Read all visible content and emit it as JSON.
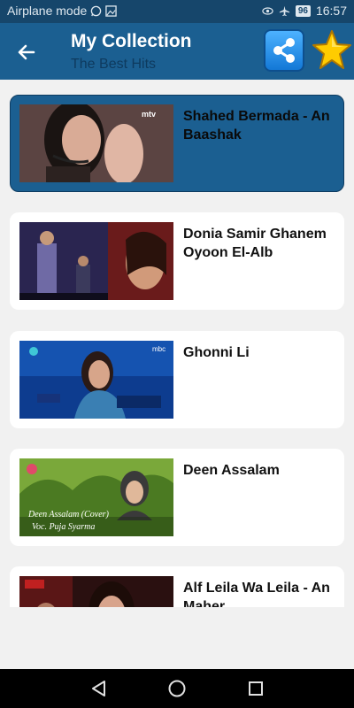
{
  "status_bar": {
    "mode": "Airplane mode",
    "battery": "96",
    "time": "16:57",
    "icons": [
      "whatsapp-icon",
      "image-icon",
      "eye-icon",
      "airplane-icon",
      "battery-icon"
    ]
  },
  "app_bar": {
    "title": "My Collection",
    "subtitle": "The Best Hits",
    "back_icon": "arrow-left-icon",
    "share_icon": "share-icon",
    "favorite_icon": "star-icon"
  },
  "videos": [
    {
      "title": "Shahed Bermada - An Baashak",
      "selected": true
    },
    {
      "title": "Donia Samir Ghanem Oyoon El-Alb",
      "selected": false
    },
    {
      "title": "Ghonni Li",
      "selected": false
    },
    {
      "title": "Deen Assalam",
      "selected": false
    },
    {
      "title": "Alf Leila Wa Leila - An Maher",
      "selected": false
    }
  ],
  "thumbnail_text": {
    "t1_logo": "mtv",
    "t3_logo": "mbc",
    "t4_caption_1": "Deen Assalam (Cover)",
    "t4_caption_2": "Voc. Puja Syarma"
  },
  "nav_bar": {
    "icons": [
      "back-triangle-icon",
      "home-circle-icon",
      "recents-square-icon"
    ]
  },
  "colors": {
    "status_bar": "#16466b",
    "app_bar": "#1b5f91",
    "selected_card": "#1b5f91",
    "background": "#f1f1f1"
  }
}
